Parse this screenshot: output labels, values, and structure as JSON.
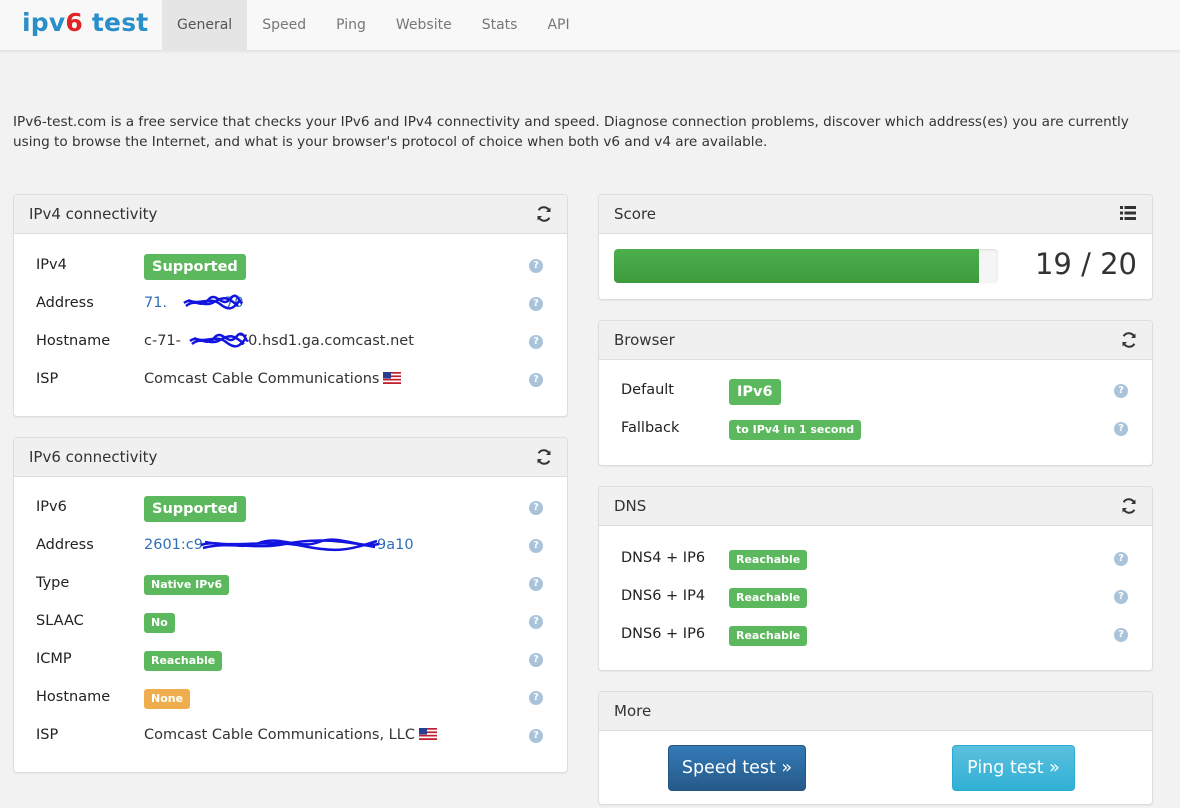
{
  "brand": {
    "part1": "ipv",
    "part2": "6",
    "part3": " test"
  },
  "nav": [
    "General",
    "Speed",
    "Ping",
    "Website",
    "Stats",
    "API"
  ],
  "intro": "IPv6-test.com is a free service that checks your IPv6 and IPv4 connectivity and speed. Diagnose connection problems, discover which address(es) you are currently using to browse the Internet, and what is your browser's protocol of choice when both v6 and v4 are available.",
  "ipv4": {
    "title": "IPv4 connectivity",
    "rows": [
      {
        "label": "IPv4",
        "value": "Supported"
      },
      {
        "label": "Address",
        "value": "71.    70"
      },
      {
        "label": "Hostname",
        "value": "c-71-    70.hsd1.ga.comcast.net"
      },
      {
        "label": "ISP",
        "value": "Comcast Cable Communications"
      }
    ]
  },
  "ipv6": {
    "title": "IPv6 connectivity",
    "rows": [
      {
        "label": "IPv6",
        "value": "Supported"
      },
      {
        "label": "Address",
        "value": "2601:c9            9a10"
      },
      {
        "label": "Type",
        "value": "Native IPv6"
      },
      {
        "label": "SLAAC",
        "value": "No"
      },
      {
        "label": "ICMP",
        "value": "Reachable"
      },
      {
        "label": "Hostname",
        "value": "None"
      },
      {
        "label": "ISP",
        "value": "Comcast Cable Communications, LLC"
      }
    ]
  },
  "score": {
    "title": "Score",
    "value": "19 / 20",
    "fraction": 0.95
  },
  "browser": {
    "title": "Browser",
    "rows": [
      {
        "label": "Default",
        "value": "IPv6"
      },
      {
        "label": "Fallback",
        "value": "to IPv4 in 1 second"
      }
    ]
  },
  "dns": {
    "title": "DNS",
    "rows": [
      {
        "label": "DNS4 + IP6",
        "value": "Reachable"
      },
      {
        "label": "DNS6 + IP4",
        "value": "Reachable"
      },
      {
        "label": "DNS6 + IP6",
        "value": "Reachable"
      }
    ]
  },
  "more": {
    "title": "More",
    "speed_btn": "Speed test »",
    "ping_btn": "Ping test »"
  },
  "help_glyph": "?",
  "colors": {
    "success": "#5cb85c",
    "warning": "#f0ad4e",
    "link": "#2f6fb8",
    "brand": "#2a8fc9",
    "brand_accent": "#e02424"
  }
}
